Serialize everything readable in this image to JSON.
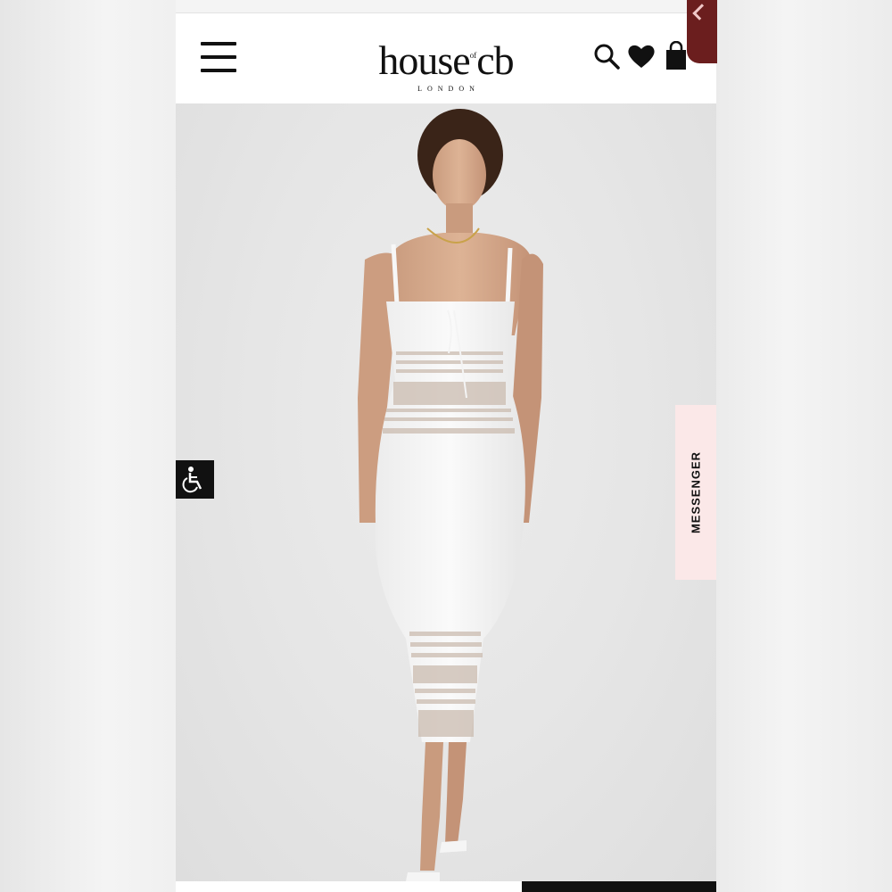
{
  "brand": {
    "name": "house",
    "of": "of",
    "suffix": "cb",
    "city": "LONDON"
  },
  "header": {
    "menu_icon": "hamburger-menu-icon",
    "search_icon": "search-icon",
    "wishlist_icon": "heart-icon",
    "bag_icon": "shopping-bag-icon"
  },
  "hero": {
    "image": "model-in-white-knit-midi-dress",
    "accessibility_icon": "wheelchair-accessibility-icon",
    "messenger_label": "MESSENGER"
  },
  "colors": {
    "header_bg": "#ffffff",
    "hero_bg": "#e6e6e6",
    "messenger_bg": "#fbe8e8",
    "accent_dark": "#111111",
    "corner_tab": "#6b1e1e"
  }
}
